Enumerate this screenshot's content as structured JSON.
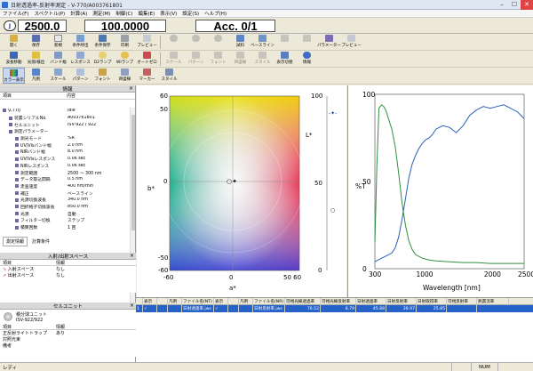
{
  "window": {
    "title": "日射透過率-反射率測定 - V-770/A003761801"
  },
  "menu": [
    "ファイル(F)",
    "スペクトル(P)",
    "計算(A)",
    "測定(M)",
    "制御(C)",
    "編集(E)",
    "表示(V)",
    "設定(S)",
    "ヘルプ(H)"
  ],
  "readout": {
    "wavelength": "2500.0",
    "value": "100.0000",
    "acc": "Acc. 0/1"
  },
  "toolbar1": [
    "開く",
    "保存",
    "新規",
    "条件呼出",
    "条件保存",
    "印刷",
    "プレビュー",
    "",
    "",
    "",
    "試料",
    "ベースライン",
    "",
    "",
    "パラメーター",
    "プレビュー"
  ],
  "toolbar2": [
    "波長移動",
    "光源/検出",
    "バンド幅",
    "レスポンス",
    "D2ランプ",
    "WIランプ",
    "オートゼロ",
    "スケール",
    "パターン",
    "フォント",
    "目盛線",
    "スタイル",
    "表示切替",
    "情報"
  ],
  "toolbar3": [
    "カラー表示",
    "凡例",
    "スケール",
    "パターン",
    "フォント",
    "目盛線",
    "マーカー",
    "スタイル"
  ],
  "info_panel": {
    "header": "情報",
    "col_item": "項目",
    "col_content": "内容",
    "rows": [
      {
        "k": "V-770",
        "v": "idle"
      },
      {
        "k": "装置シリアルNo.",
        "v": "A003761801"
      },
      {
        "k": "セルユニット",
        "v": "ISV-922 / 922"
      },
      {
        "k": "測定パラメーター",
        "v": ""
      },
      {
        "k": "測光モード",
        "v": "%R"
      },
      {
        "k": "UV/Visバンド幅",
        "v": "2.0 nm"
      },
      {
        "k": "NIRバンド幅",
        "v": "8.0 nm"
      },
      {
        "k": "UV/Visレスポンス",
        "v": "0.06 sec"
      },
      {
        "k": "NIRレスポンス",
        "v": "0.06 sec"
      },
      {
        "k": "測定範囲",
        "v": "2500 ～ 300 nm"
      },
      {
        "k": "データ取込間隔",
        "v": "0.5 nm"
      },
      {
        "k": "走査速度",
        "v": "400 nm/min"
      },
      {
        "k": "補正",
        "v": "ベースライン"
      },
      {
        "k": "光源切換波長",
        "v": "340.0 nm"
      },
      {
        "k": "回折格子切換波長",
        "v": "850.0 nm"
      },
      {
        "k": "光源",
        "v": "自動"
      },
      {
        "k": "フィルター切換",
        "v": "ステップ"
      },
      {
        "k": "積算回数",
        "v": "1 回"
      }
    ],
    "tabs": [
      "測定情報",
      "計算条件"
    ]
  },
  "space_panel": {
    "header": "入射/出射スペース",
    "col_item": "項目",
    "col_content": "情報",
    "rows": [
      {
        "k": "入射スペース",
        "v": "なし"
      },
      {
        "k": "出射スペース",
        "v": "なし"
      }
    ]
  },
  "cell_panel": {
    "header": "セルユニット",
    "name": "積分球ユニット",
    "model": "ISV-922/922",
    "col_item": "項目",
    "col_content": "情報",
    "rows": [
      {
        "k": "正反射ライトトラップ",
        "v": "あり"
      },
      {
        "k": "対照光束",
        "v": ""
      },
      {
        "k": "備考",
        "v": ""
      }
    ]
  },
  "color_chart": {
    "xlabel": "a*",
    "ylabel": "b*",
    "lstar_label": "L*",
    "x_ticks": [
      "-60",
      "0",
      "50 60"
    ],
    "y_ticks": [
      "60",
      "50",
      "0",
      "-50",
      "-60"
    ],
    "l_ticks": [
      "100",
      "50",
      "0"
    ],
    "point": {
      "a": 0,
      "b": 0
    }
  },
  "chart_data": {
    "type": "line",
    "xlabel": "Wavelength [nm]",
    "ylabel": "%T",
    "xlim": [
      300,
      2500
    ],
    "ylim": [
      0,
      100
    ],
    "x_ticks": [
      "300",
      "1000",
      "2000",
      "2500"
    ],
    "y_ticks": [
      "100",
      "50",
      "0"
    ],
    "series": [
      {
        "color": "#2a5fb8",
        "x": [
          300,
          350,
          400,
          450,
          500,
          550,
          600,
          650,
          700,
          750,
          800,
          850,
          900,
          950,
          1000,
          1050,
          1100,
          1150,
          1200,
          1300,
          1400,
          1500,
          1600,
          1700,
          1800,
          1900,
          2000,
          2100,
          2200,
          2300,
          2400,
          2500
        ],
        "y": [
          4,
          5,
          6,
          7,
          8,
          9,
          12,
          18,
          28,
          40,
          52,
          60,
          65,
          69,
          72,
          74,
          75,
          77,
          80,
          82,
          81,
          78,
          82,
          88,
          91,
          93,
          92,
          93,
          94,
          92,
          90,
          86
        ]
      },
      {
        "color": "#2f8f3e",
        "x": [
          300,
          330,
          360,
          400,
          430,
          460,
          500,
          550,
          600,
          650,
          700,
          750,
          800,
          850,
          900,
          1000,
          1100,
          1200,
          1400,
          1600,
          1800,
          2000,
          2200,
          2500
        ],
        "y": [
          15,
          60,
          92,
          94,
          93,
          91,
          86,
          80,
          70,
          55,
          38,
          25,
          16,
          11,
          8,
          6,
          5,
          4.5,
          4,
          3.5,
          3.5,
          3,
          3,
          3
        ]
      }
    ]
  },
  "table": {
    "headers": [
      "",
      "表示",
      "",
      "凡例",
      "ファイル名(NT)",
      "表示",
      "",
      "凡例",
      "ファイル名(NR)",
      "可視光線透過率",
      "可視光線反射率",
      "日射透過率",
      "日射反射率",
      "日射取得率",
      "可視反射率",
      "熱貫流率"
    ],
    "row": [
      "1",
      "✓",
      "",
      "",
      "日射透過率.jws",
      "✓",
      "",
      "",
      "日射反射率.jws",
      "76.52",
      "8.79",
      "45.88",
      "28.97",
      "25.85",
      ""
    ]
  },
  "status": {
    "left": "レディ",
    "num": "NUM"
  }
}
